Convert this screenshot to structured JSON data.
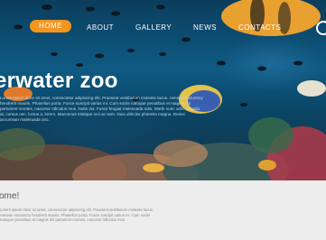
{
  "nav": {
    "items": [
      {
        "label": "HOME",
        "active": true
      },
      {
        "label": "ABOUT",
        "active": false
      },
      {
        "label": "GALLERY",
        "active": false
      },
      {
        "label": "NEWS",
        "active": false
      },
      {
        "label": "CONTACTS",
        "active": false
      }
    ],
    "accent_color": "#f3961f"
  },
  "hero": {
    "title": "erwater zoo",
    "text": "Lorem ipsum dolor sit amet, consectetur adipiscing elit. Praesent vestibulum molestie lacus. Aenean nonummy hendrerit mauris. Phasellus porta. Fusce suscipit varius mi. Cum sociis natoque penatibus et magnis dis parturient montes, nascetur ridiculus mus. Nulla dui. Fusce feugiat malesuada odio. Morbi nunc odio, gravida at, cursus nec, luctus a, lorem. Maecenas tristique orci ac sem. Duis ultricies pharetra magna. Donec accumsan malesuada orci."
  },
  "intro": {
    "title": "come!",
    "text": "Lorem ipsum dolor sit amet, consectetur adipiscing elit. Praesent vestibulum molestie lacus. Aenean nonummy hendrerit mauris. Phasellus porta. Fusce suscipit varius mi. Cum sociis natoque penatibus et magnis dis parturient montes, nascetur ridiculus mus."
  }
}
